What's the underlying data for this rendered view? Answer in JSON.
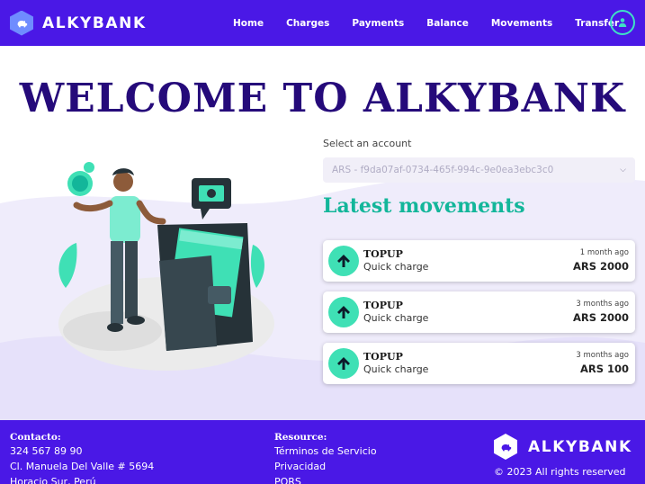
{
  "brand": {
    "name": "ALKYBANK"
  },
  "nav": {
    "links": [
      "Home",
      "Charges",
      "Payments",
      "Balance",
      "Movements",
      "Transfer"
    ]
  },
  "hero": {
    "title": "WELCOME TO ALKYBANK"
  },
  "account": {
    "label": "Select an account",
    "selected": "ARS - f9da07af-0734-465f-994c-9e0ea3ebc3c0"
  },
  "movements": {
    "title": "Latest movements",
    "items": [
      {
        "type": "TOPUP",
        "desc": "Quick charge",
        "time": "1 month ago",
        "amount": "ARS 2000"
      },
      {
        "type": "TOPUP",
        "desc": "Quick charge",
        "time": "3 months ago",
        "amount": "ARS 2000"
      },
      {
        "type": "TOPUP",
        "desc": "Quick charge",
        "time": "3 months ago",
        "amount": "ARS 100"
      }
    ]
  },
  "footer": {
    "contact": {
      "heading": "Contacto:",
      "lines": [
        "324 567 89 90",
        "Cl. Manuela Del Valle # 5694",
        "Horacio Sur, Perú"
      ]
    },
    "resources": {
      "heading": "Resource:",
      "lines": [
        "Términos de Servicio",
        "Privacidad",
        "PQRS"
      ]
    },
    "brand": "ALKYBANK",
    "copyright": "© 2023 All rights reserved"
  },
  "colors": {
    "primary": "#4a18e6",
    "accent": "#3fe0b5",
    "heading": "#250a7a",
    "teal_heading": "#13b69a"
  },
  "icons": {
    "brand": "piggy-bank-icon",
    "user": "user-icon",
    "movement": "arrow-up-icon",
    "select": "chevron-down-icon"
  }
}
